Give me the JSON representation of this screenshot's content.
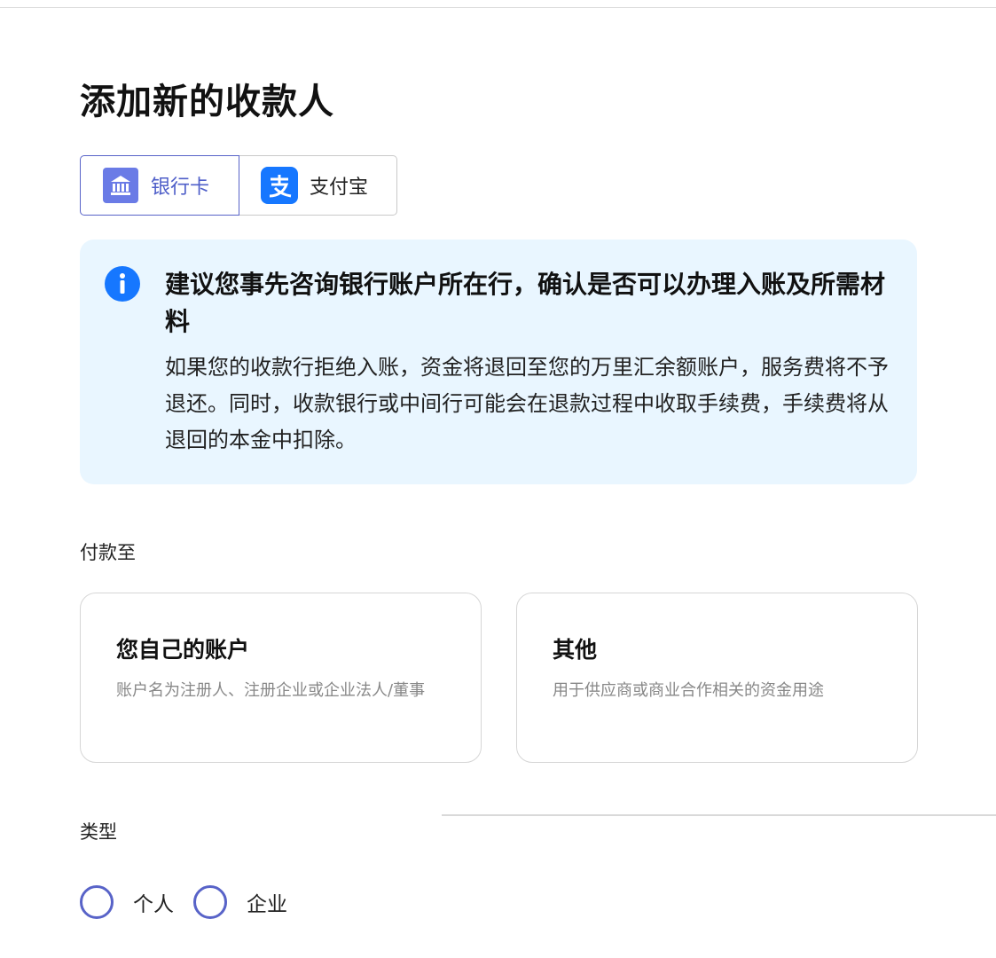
{
  "page": {
    "title": "添加新的收款人"
  },
  "methods": {
    "bank": {
      "label": "银行卡",
      "icon": "bank-icon",
      "selected": true
    },
    "alipay": {
      "label": "支付宝",
      "icon": "alipay-icon",
      "selected": false
    }
  },
  "notice": {
    "icon": "info-icon",
    "title": "建议您事先咨询银行账户所在行，确认是否可以办理入账及所需材料",
    "body": "如果您的收款行拒绝入账，资金将退回至您的万里汇余额账户，服务费将不予退还。同时，收款银行或中间行可能会在退款过程中收取手续费，手续费将从退回的本金中扣除。"
  },
  "pay_to": {
    "label": "付款至",
    "own": {
      "title": "您自己的账户",
      "desc": "账户名为注册人、注册企业或企业法人/董事"
    },
    "other": {
      "title": "其他",
      "desc": "用于供应商或商业合作相关的资金用途"
    }
  },
  "type": {
    "label": "类型",
    "individual": "个人",
    "company": "企业"
  },
  "colors": {
    "accent": "#5863c8",
    "notice_bg": "#e9f6ff",
    "info_blue": "#1677ff",
    "alipay_blue": "#1677ff"
  }
}
